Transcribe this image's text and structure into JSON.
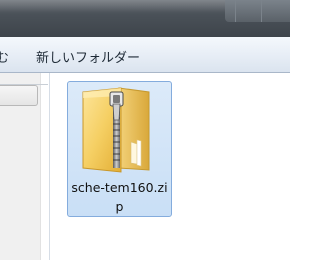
{
  "toolbar": {
    "left_partial_label": "む",
    "new_folder_label": "新しいフォルダー"
  },
  "file": {
    "name": "sche-tem160.zip",
    "icon": "zip-folder-icon",
    "selected": true
  },
  "colors": {
    "selection_fill": "#c9dff6",
    "selection_border": "#84acdd",
    "folder_yellow": "#f2cc5c"
  }
}
